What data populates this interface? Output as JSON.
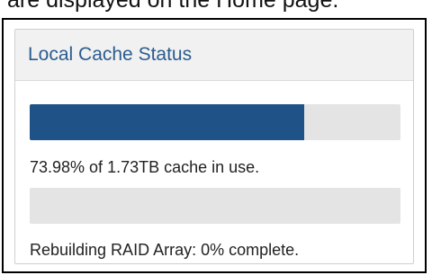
{
  "intro_text": "are displayed on the Home page.",
  "cache_panel": {
    "title": "Local Cache Status",
    "cache_usage_percent": 73.98,
    "cache_usage_text": "73.98% of 1.73TB cache in use.",
    "raid_rebuild_percent": 0,
    "raid_rebuild_text": "Rebuilding RAID Array: 0% complete.",
    "colors": {
      "title": "#2a5c8f",
      "bar_fill": "#1f5287",
      "bar_track": "#e4e4e4",
      "header_bg": "#f1f1f1"
    }
  }
}
